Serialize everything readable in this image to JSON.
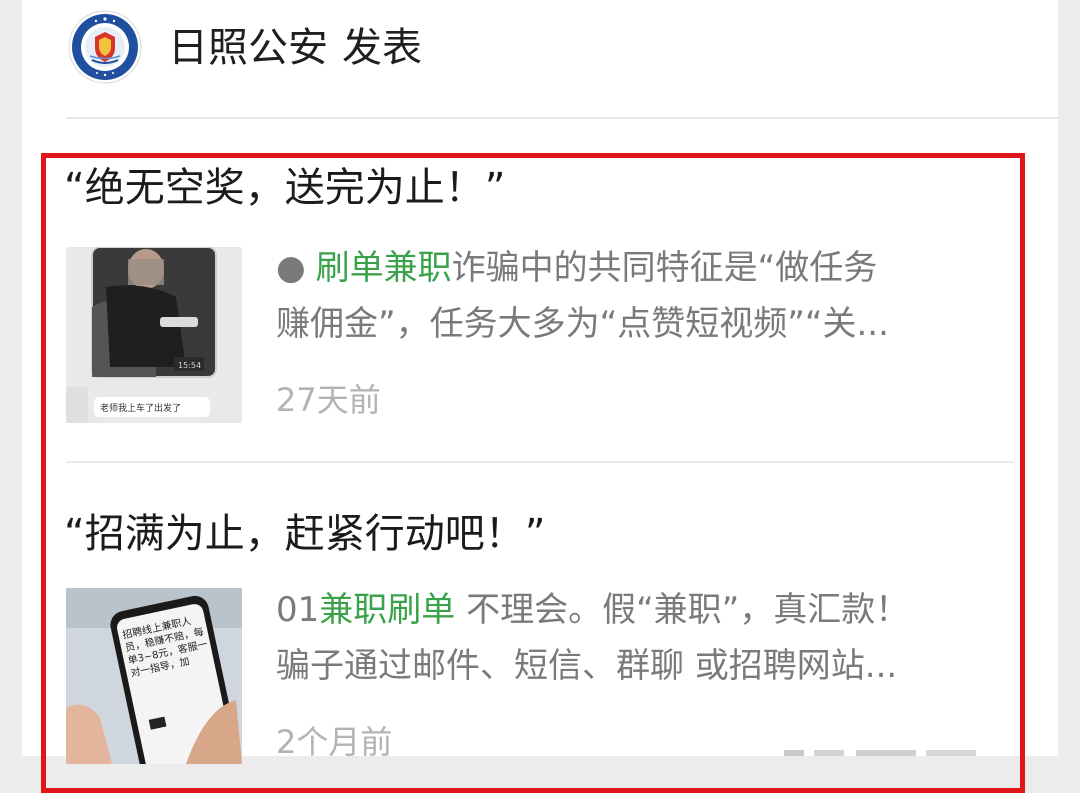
{
  "header": {
    "account_name": "日照公安",
    "action": "发表",
    "logo_icon": "police-badge-logo"
  },
  "articles": [
    {
      "title": "“绝无空奖，送完为止！”",
      "thumbnail_caption": "老师我上车了出发了",
      "thumbnail_time": "15:54",
      "bullet": "●",
      "keyword": "刷单兼职",
      "summary_line1_rest": "诈骗中的共同特征是“做任务",
      "summary_line2": "赚佣金”，任务大多为“点赞短视频”“关...",
      "time": "27天前"
    },
    {
      "title": "“招满为止，赶紧行动吧！”",
      "thumbnail_phone_text": "招聘线上兼职人员，稳赚不赔，每单3~8元，客服一对一指导，加",
      "prefix": "01",
      "keyword": "兼职刷单",
      "summary_line1_rest": " 不理会。假“兼职”，真汇款！",
      "summary_line2": "骗子通过邮件、短信、群聊 或招聘网站...",
      "time": "2个月前"
    }
  ],
  "colors": {
    "highlight_border": "#e0161b",
    "keyword_green": "#3aa24a",
    "summary_gray": "#7a7a7a",
    "time_gray": "#b3b3b3"
  }
}
